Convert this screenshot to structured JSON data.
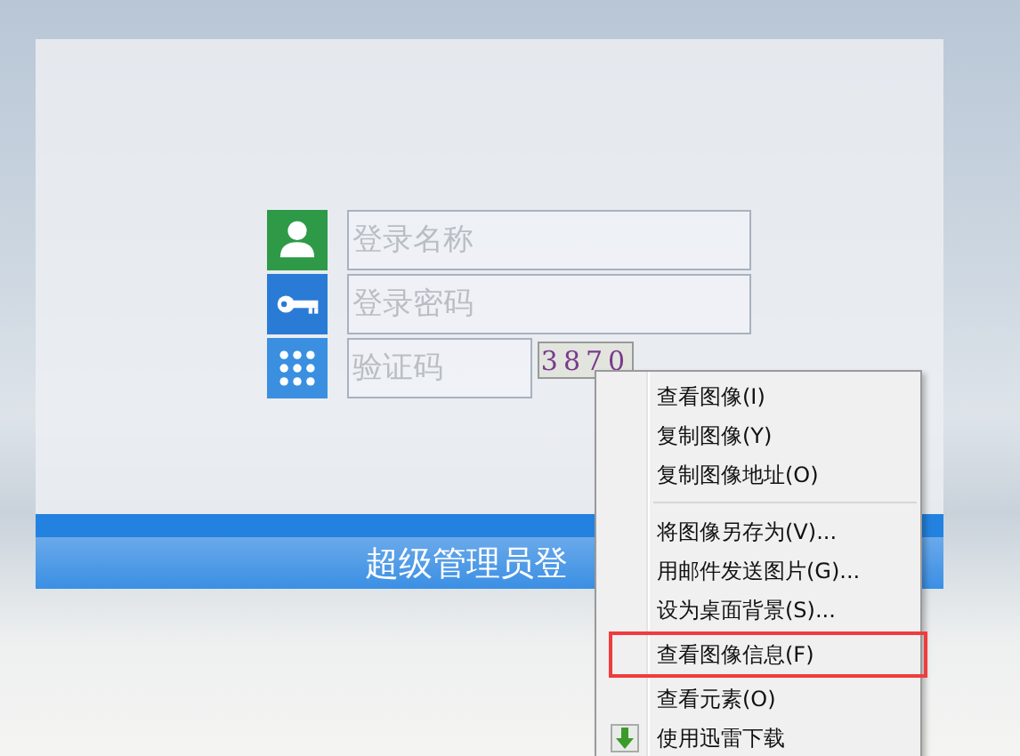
{
  "login_form": {
    "fields": [
      {
        "kind": "user",
        "placeholder": "登录名称"
      },
      {
        "kind": "password",
        "placeholder": "登录密码"
      },
      {
        "kind": "captcha",
        "placeholder": "验证码",
        "captcha_text": "3870"
      }
    ],
    "submit_button": "超级管理员登"
  },
  "context_menu": {
    "groups": [
      [
        {
          "label": "查看图像(I)",
          "highlighted": false
        },
        {
          "label": "复制图像(Y)",
          "highlighted": false
        },
        {
          "label": "复制图像地址(O)",
          "highlighted": false
        }
      ],
      [
        {
          "label": "将图像另存为(V)...",
          "highlighted": false
        },
        {
          "label": "用邮件发送图片(G)...",
          "highlighted": false
        },
        {
          "label": "设为桌面背景(S)...",
          "highlighted": false
        },
        {
          "label": "查看图像信息(F)",
          "highlighted": true
        },
        {
          "label": "查看元素(O)",
          "highlighted": false
        },
        {
          "label": "使用迅雷下载",
          "highlighted": false,
          "kind": "download"
        }
      ]
    ]
  }
}
